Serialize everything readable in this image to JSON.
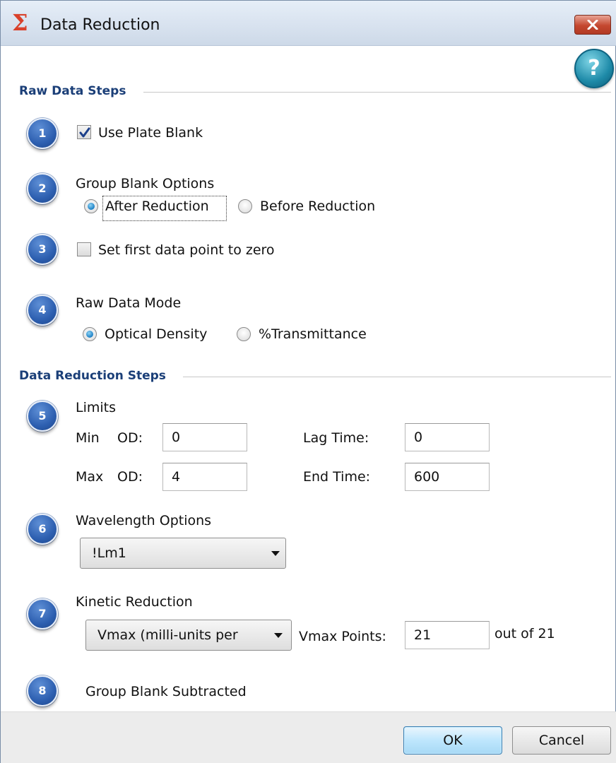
{
  "window": {
    "title": "Data Reduction",
    "icon": "sigma-icon",
    "accent_color": "#1b3f78"
  },
  "sections": {
    "raw_data_steps": "Raw Data Steps",
    "data_reduction_steps": "Data Reduction Steps"
  },
  "steps": {
    "s1": {
      "number": "1",
      "checkbox_label": "Use Plate Blank",
      "checked": true
    },
    "s2": {
      "number": "2",
      "title": "Group Blank Options",
      "options": [
        "After Reduction",
        "Before Reduction"
      ],
      "selected": "After Reduction"
    },
    "s3": {
      "number": "3",
      "checkbox_label": "Set first data point to zero",
      "checked": false
    },
    "s4": {
      "number": "4",
      "title": "Raw Data Mode",
      "options": [
        "Optical Density",
        "%Transmittance"
      ],
      "selected": "Optical Density"
    },
    "s5": {
      "number": "5",
      "title": "Limits",
      "min_label": "Min",
      "max_label": "Max",
      "od_label": "OD:",
      "min_od": "0",
      "max_od": "4",
      "lag_time_label": "Lag Time:",
      "lag_time": "0",
      "end_time_label": "End Time:",
      "end_time": "600"
    },
    "s6": {
      "number": "6",
      "title": "Wavelength Options",
      "selected": "!Lm1"
    },
    "s7": {
      "number": "7",
      "title": "Kinetic Reduction",
      "selected": "Vmax (milli-units per",
      "vmax_points_label": "Vmax Points:",
      "vmax_points": "21",
      "out_of": "out of 21"
    },
    "s8": {
      "number": "8",
      "title": "Group Blank Subtracted"
    }
  },
  "footer": {
    "ok": "OK",
    "cancel": "Cancel"
  }
}
